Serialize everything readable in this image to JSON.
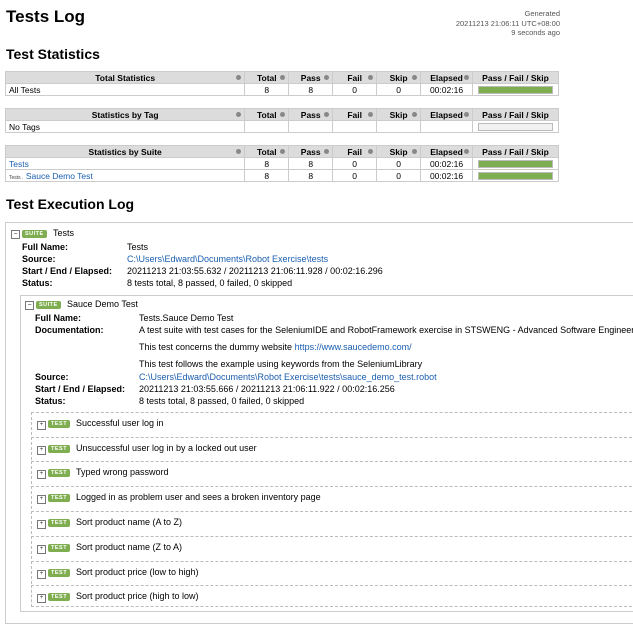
{
  "header": {
    "title": "Tests Log",
    "generated_label": "Generated",
    "generated_time": "20211213 21:06:11 UTC+08:00",
    "ago": "9 seconds ago"
  },
  "statistics": {
    "heading": "Test Statistics",
    "columns": [
      "Total",
      "Pass",
      "Fail",
      "Skip",
      "Elapsed",
      "Pass / Fail / Skip"
    ],
    "total": {
      "header": "Total Statistics",
      "row": {
        "name": "All Tests",
        "total": "8",
        "pass": "8",
        "fail": "0",
        "skip": "0",
        "elapsed": "00:02:16",
        "pass_fraction": 1.0
      }
    },
    "tag": {
      "header": "Statistics by Tag",
      "row": {
        "name": "No Tags"
      }
    },
    "suite": {
      "header": "Statistics by Suite",
      "rows": [
        {
          "name": "Tests",
          "prefix": "",
          "total": "8",
          "pass": "8",
          "fail": "0",
          "skip": "0",
          "elapsed": "00:02:16",
          "pass_fraction": 1.0
        },
        {
          "name": "Sauce Demo Test",
          "prefix": "Tests .",
          "total": "8",
          "pass": "8",
          "fail": "0",
          "skip": "0",
          "elapsed": "00:02:16",
          "pass_fraction": 1.0
        }
      ]
    }
  },
  "log": {
    "heading": "Test Execution Log",
    "badge_suite": "SUITE",
    "badge_test": "TEST",
    "labels": {
      "full_name": "Full Name:",
      "documentation": "Documentation:",
      "source": "Source:",
      "times": "Start / End / Elapsed:",
      "status": "Status:"
    },
    "suite": {
      "name": "Tests",
      "full_name": "Tests",
      "source": "C:\\Users\\Edward\\Documents\\Robot Exercise\\tests",
      "times": "20211213 21:03:55.632 / 20211213 21:06:11.928 / 00:02:16.296",
      "status": "8 tests total, 8 passed, 0 failed, 0 skipped"
    },
    "subsuite": {
      "name": "Sauce Demo Test",
      "full_name": "Tests.Sauce Demo Test",
      "doc1": "A test suite with test cases for the SeleniumIDE and RobotFramework exercise in STSWENG - Advanced Software Engineering",
      "doc2_text": "This test concerns the dummy website ",
      "doc2_link": "https://www.saucedemo.com/",
      "doc3": "This test follows the example using keywords from the SeleniumLibrary",
      "source": "C:\\Users\\Edward\\Documents\\Robot Exercise\\tests\\sauce_demo_test.robot",
      "times": "20211213 21:03:55.666 / 20211213 21:06:11.922 / 00:02:16.256",
      "status": "8 tests total, 8 passed, 0 failed, 0 skipped"
    },
    "tests": [
      "Successful user log in",
      "Unsuccessful user log in by a locked out user",
      "Typed wrong password",
      "Logged in as problem user and sees a broken inventory page",
      "Sort product name (A to Z)",
      "Sort product name (Z to A)",
      "Sort product price (low to high)",
      "Sort product price (high to low)"
    ]
  },
  "colors": {
    "pass": "#7fae50",
    "link": "#1a5eb0",
    "header_bg": "#dcdcdc"
  },
  "icons": {
    "toggle": "minus-icon",
    "test_toggle": "plus-icon",
    "sort": "sort-dot-icon"
  }
}
